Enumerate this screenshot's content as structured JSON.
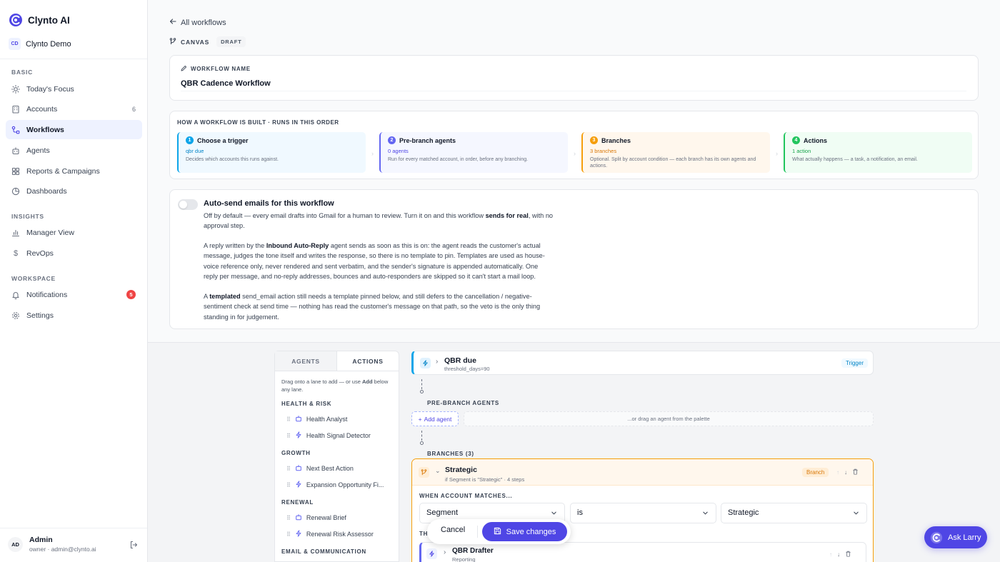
{
  "app": {
    "name": "Clynto AI",
    "org_initials": "CD",
    "org_name": "Clynto Demo"
  },
  "sidebar": {
    "sections": {
      "basic": "BASIC",
      "insights": "INSIGHTS",
      "workspace": "WORKSPACE"
    },
    "items": [
      {
        "label": "Today's Focus",
        "icon": "sun-icon"
      },
      {
        "label": "Accounts",
        "icon": "building-icon",
        "count": "6"
      },
      {
        "label": "Workflows",
        "icon": "workflow-icon",
        "active": true
      },
      {
        "label": "Agents",
        "icon": "robot-icon"
      },
      {
        "label": "Reports & Campaigns",
        "icon": "grid-icon"
      },
      {
        "label": "Dashboards",
        "icon": "pie-chart-icon"
      },
      {
        "label": "Manager View",
        "icon": "bar-chart-icon"
      },
      {
        "label": "RevOps",
        "icon": "dollar-icon"
      },
      {
        "label": "Notifications",
        "icon": "bell-icon",
        "badge": "5"
      },
      {
        "label": "Settings",
        "icon": "gear-icon"
      }
    ],
    "user": {
      "initials": "AD",
      "name": "Admin",
      "sub": "owner · admin@clynto.ai"
    }
  },
  "header": {
    "back": "All workflows",
    "canvas_label": "CANVAS",
    "status": "DRAFT"
  },
  "workflow": {
    "name_label": "WORKFLOW NAME",
    "name": "QBR Cadence Workflow"
  },
  "how": {
    "title": "HOW A WORKFLOW IS BUILT · RUNS IN THIS ORDER",
    "steps": [
      {
        "num": "1",
        "title": "Choose a trigger",
        "value": "qbr due",
        "desc": "Decides which accounts this runs against.",
        "color": "#0ea5e9"
      },
      {
        "num": "2",
        "title": "Pre-branch agents",
        "value": "0 agents",
        "desc": "Run for every matched account, in order, before any branching.",
        "color": "#6366f1"
      },
      {
        "num": "3",
        "title": "Branches",
        "value": "3 branches",
        "desc": "Optional. Split by account condition — each branch has its own agents and actions.",
        "color": "#f59e0b"
      },
      {
        "num": "4",
        "title": "Actions",
        "value": "1 action",
        "desc": "What actually happens — a task, a notification, an email.",
        "color": "#22c55e"
      }
    ]
  },
  "auto_send": {
    "title": "Auto-send emails for this workflow",
    "enabled": false,
    "p1_a": "Off by default — every email drafts into Gmail for a human to review. Turn it on and this workflow ",
    "p1_b": "sends for real",
    "p1_c": ", with no approval step.",
    "p2_a": "A reply written by the ",
    "p2_b": "Inbound Auto-Reply",
    "p2_c": " agent sends as soon as this is on: the agent reads the customer's actual message, judges the tone itself and writes the response, so there is no template to pin. Templates are used as house-voice reference only, never rendered and sent verbatim, and the sender's signature is appended automatically. One reply per message, and no-reply addresses, bounces and auto-responders are skipped so it can't start a mail loop.",
    "p3_a": "A ",
    "p3_b": "templated",
    "p3_c": " send_email action still needs a template pinned below, and still defers to the cancellation / negative-sentiment check at send time — nothing has read the customer's message on that path, so the veto is the only thing standing in for judgement."
  },
  "palette": {
    "tabs": [
      "AGENTS",
      "ACTIONS"
    ],
    "active_tab": "ACTIONS",
    "hint_a": "Drag onto a lane to add — or use ",
    "hint_b": "Add",
    "hint_c": " below any lane.",
    "groups": [
      {
        "label": "HEALTH & RISK",
        "items": [
          {
            "label": "Health Analyst",
            "icon": "robot-icon"
          },
          {
            "label": "Health Signal Detector",
            "icon": "bolt-icon"
          }
        ]
      },
      {
        "label": "GROWTH",
        "items": [
          {
            "label": "Next Best Action",
            "icon": "robot-icon"
          },
          {
            "label": "Expansion Opportunity Fi...",
            "icon": "bolt-icon"
          }
        ]
      },
      {
        "label": "RENEWAL",
        "items": [
          {
            "label": "Renewal Brief",
            "icon": "robot-icon"
          },
          {
            "label": "Renewal Risk Assessor",
            "icon": "bolt-icon"
          }
        ]
      },
      {
        "label": "EMAIL & COMMUNICATION",
        "items": []
      }
    ]
  },
  "flow": {
    "trigger": {
      "title": "QBR due",
      "sub": "threshold_days=90",
      "tag": "Trigger"
    },
    "pre_branch_label": "PRE-BRANCH AGENTS",
    "add_agent": "Add agent",
    "drop_hint": "...or drag an agent from the palette",
    "branches_label": "BRANCHES (3)",
    "branch": {
      "title": "Strategic",
      "sub": "if Segment is \"Strategic\" · 4 steps",
      "tag": "Branch",
      "match_label": "WHEN ACCOUNT MATCHES...",
      "field": "Segment",
      "operator": "is",
      "value": "Strategic",
      "then_label": "THEN",
      "agent": {
        "title": "QBR Drafter",
        "sub": "Reporting"
      }
    }
  },
  "save_bar": {
    "cancel": "Cancel",
    "save": "Save changes"
  },
  "assistant": {
    "label": "Ask Larry"
  },
  "colors": {
    "accent": "#4f46e5",
    "trigger": "#0ea5e9",
    "branch": "#f59e0b",
    "action": "#22c55e"
  }
}
